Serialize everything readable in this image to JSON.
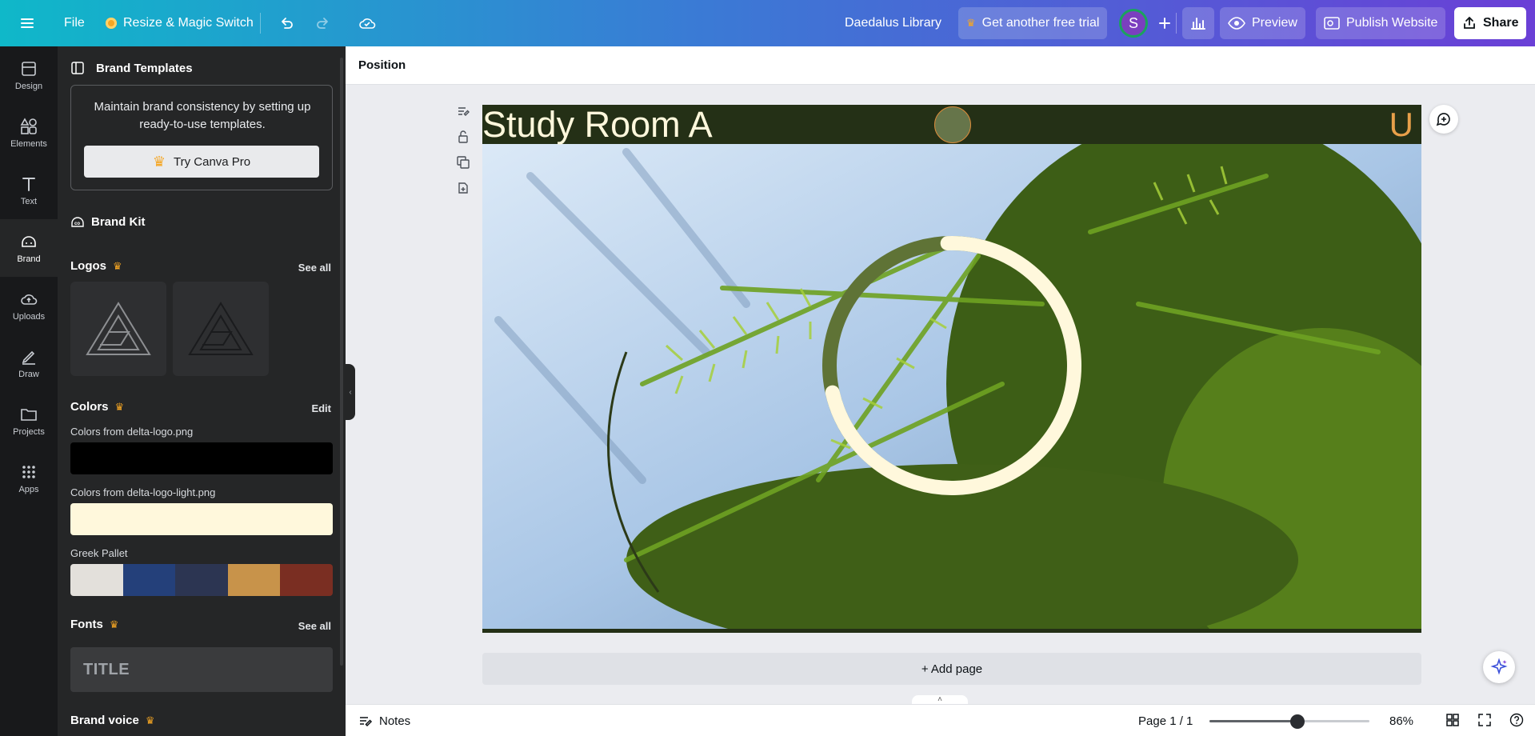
{
  "topbar": {
    "file": "File",
    "resize": "Resize & Magic Switch",
    "doc_title": "Daedalus Library",
    "trial": "Get another free trial",
    "avatar": "S",
    "preview": "Preview",
    "publish": "Publish Website",
    "share": "Share"
  },
  "rail": {
    "items": [
      {
        "label": "Design"
      },
      {
        "label": "Elements"
      },
      {
        "label": "Text"
      },
      {
        "label": "Brand"
      },
      {
        "label": "Uploads"
      },
      {
        "label": "Draw"
      },
      {
        "label": "Projects"
      },
      {
        "label": "Apps"
      }
    ]
  },
  "panel": {
    "templates_title": "Brand Templates",
    "templates_text": "Maintain brand consistency by setting up ready-to-use templates.",
    "try_pro": "Try Canva Pro",
    "brand_kit": "Brand Kit",
    "logos_title": "Logos",
    "logos_see_all": "See all",
    "colors_title": "Colors",
    "colors_edit": "Edit",
    "colors_group1": "Colors from delta-logo.png",
    "colors_group2": "Colors from delta-logo-light.png",
    "colors_group3": "Greek Pallet",
    "fonts_title": "Fonts",
    "fonts_see_all": "See all",
    "font_sample": "TITLE",
    "voice_title": "Brand voice",
    "swatch1": "#000000",
    "swatch2": "#fff8dc",
    "palette": [
      "#e3e0db",
      "#24407a",
      "#2c3552",
      "#c8934a",
      "#7a2e22"
    ]
  },
  "context_bar": {
    "position": "Position"
  },
  "canvas": {
    "title": "Study Room A",
    "letter": "U",
    "add_page": "+ Add page",
    "ring_progress": 0.72
  },
  "bottombar": {
    "notes": "Notes",
    "page": "Page 1 / 1",
    "zoom": "86%",
    "zoom_level": 0.55
  }
}
